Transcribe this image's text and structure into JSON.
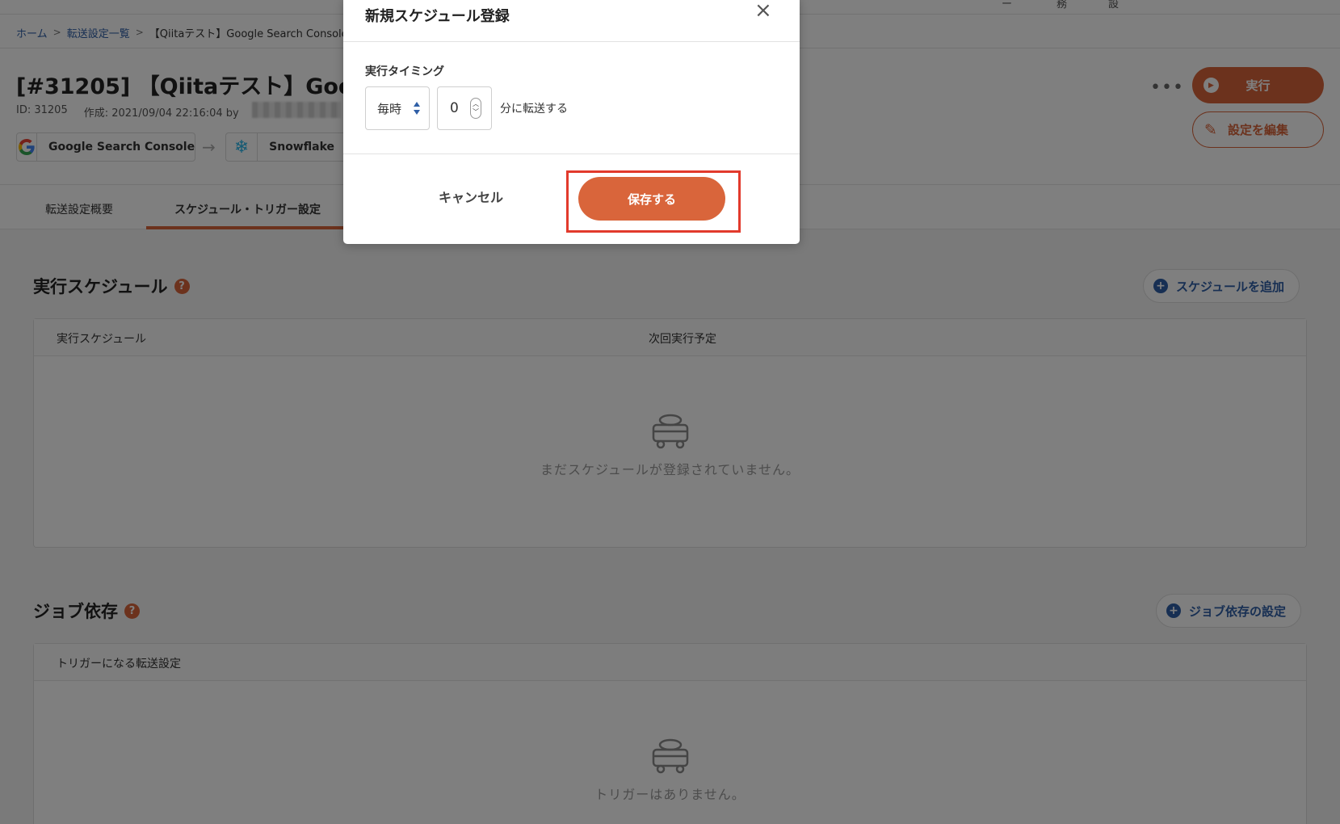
{
  "topbar": {
    "fragments": [
      "ー",
      "務",
      "設"
    ]
  },
  "breadcrumb": {
    "home": "ホーム",
    "list": "転送設定一覧",
    "current": "【Qiitaテスト】Google Search Console"
  },
  "page": {
    "title": "[#31205] 【Qiitaテスト】Google",
    "id_text": "ID: 31205",
    "created_text": "作成: 2021/09/04 22:16:04 by"
  },
  "connectors": {
    "source_label": "Google Search Console",
    "source_icon_text": "G",
    "dest_label": "Snowflake",
    "dest_icon_text": "❄",
    "arrow": "→"
  },
  "actions": {
    "more": "•••",
    "run_label": "実行",
    "edit_label": "設定を編集"
  },
  "tabs": [
    {
      "label": "転送設定概要"
    },
    {
      "label": "スケジュール・トリガー設定"
    }
  ],
  "schedule_section": {
    "title": "実行スケジュール",
    "help": "?",
    "add_label": "スケジュールを追加",
    "columns": [
      "実行スケジュール",
      "次回実行予定"
    ],
    "empty_text": "まだスケジュールが登録されていません。"
  },
  "job_section": {
    "title": "ジョブ依存",
    "help": "?",
    "add_label": "ジョブ依存の設定",
    "columns": [
      "トリガーになる転送設定"
    ],
    "empty_text": "トリガーはありません。"
  },
  "modal": {
    "title": "新規スケジュール登録",
    "close": "×",
    "field_label": "実行タイミング",
    "frequency_value": "毎時",
    "minute_value": "0",
    "suffix": "分に転送する",
    "cancel_label": "キャンセル",
    "save_label": "保存する"
  },
  "colors": {
    "accent": "#d9653b",
    "link": "#2f5fa6",
    "highlight": "#e23a2c"
  }
}
